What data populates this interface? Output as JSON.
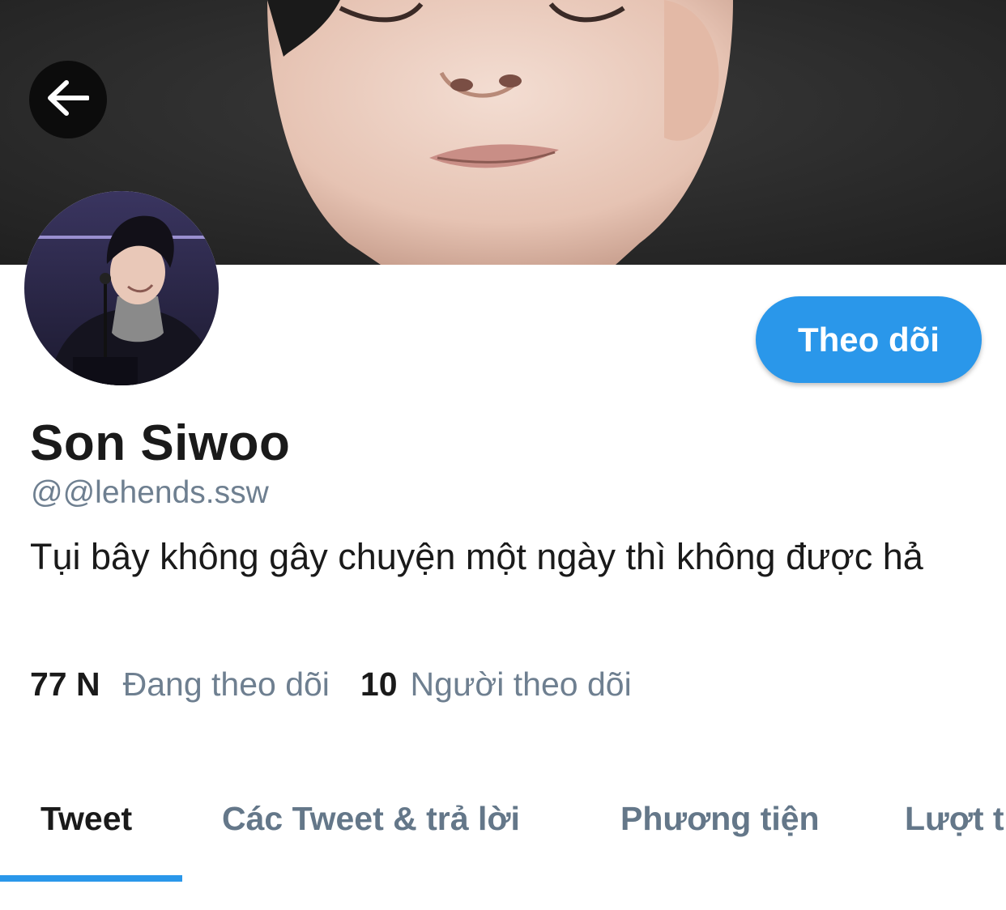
{
  "profile": {
    "display_name": "Son Siwoo",
    "handle": "@@lehends.ssw",
    "bio": "Tụi bây không gây chuyện một ngày thì không được hả",
    "follow_label": "Theo dõi"
  },
  "stats": {
    "following_count": "77 N",
    "following_label": "Đang theo dõi",
    "followers_count": "10",
    "followers_label": "Người theo dõi"
  },
  "tabs": [
    {
      "label": "Tweet",
      "active": true
    },
    {
      "label": "Các Tweet & trả lời",
      "active": false
    },
    {
      "label": "Phương tiện",
      "active": false
    },
    {
      "label": "Lượt t",
      "active": false
    }
  ],
  "icons": {
    "back": "arrow-left-icon"
  },
  "colors": {
    "accent": "#2a97ea",
    "text_primary": "#1a1a1a",
    "text_secondary": "#6e7f90"
  }
}
